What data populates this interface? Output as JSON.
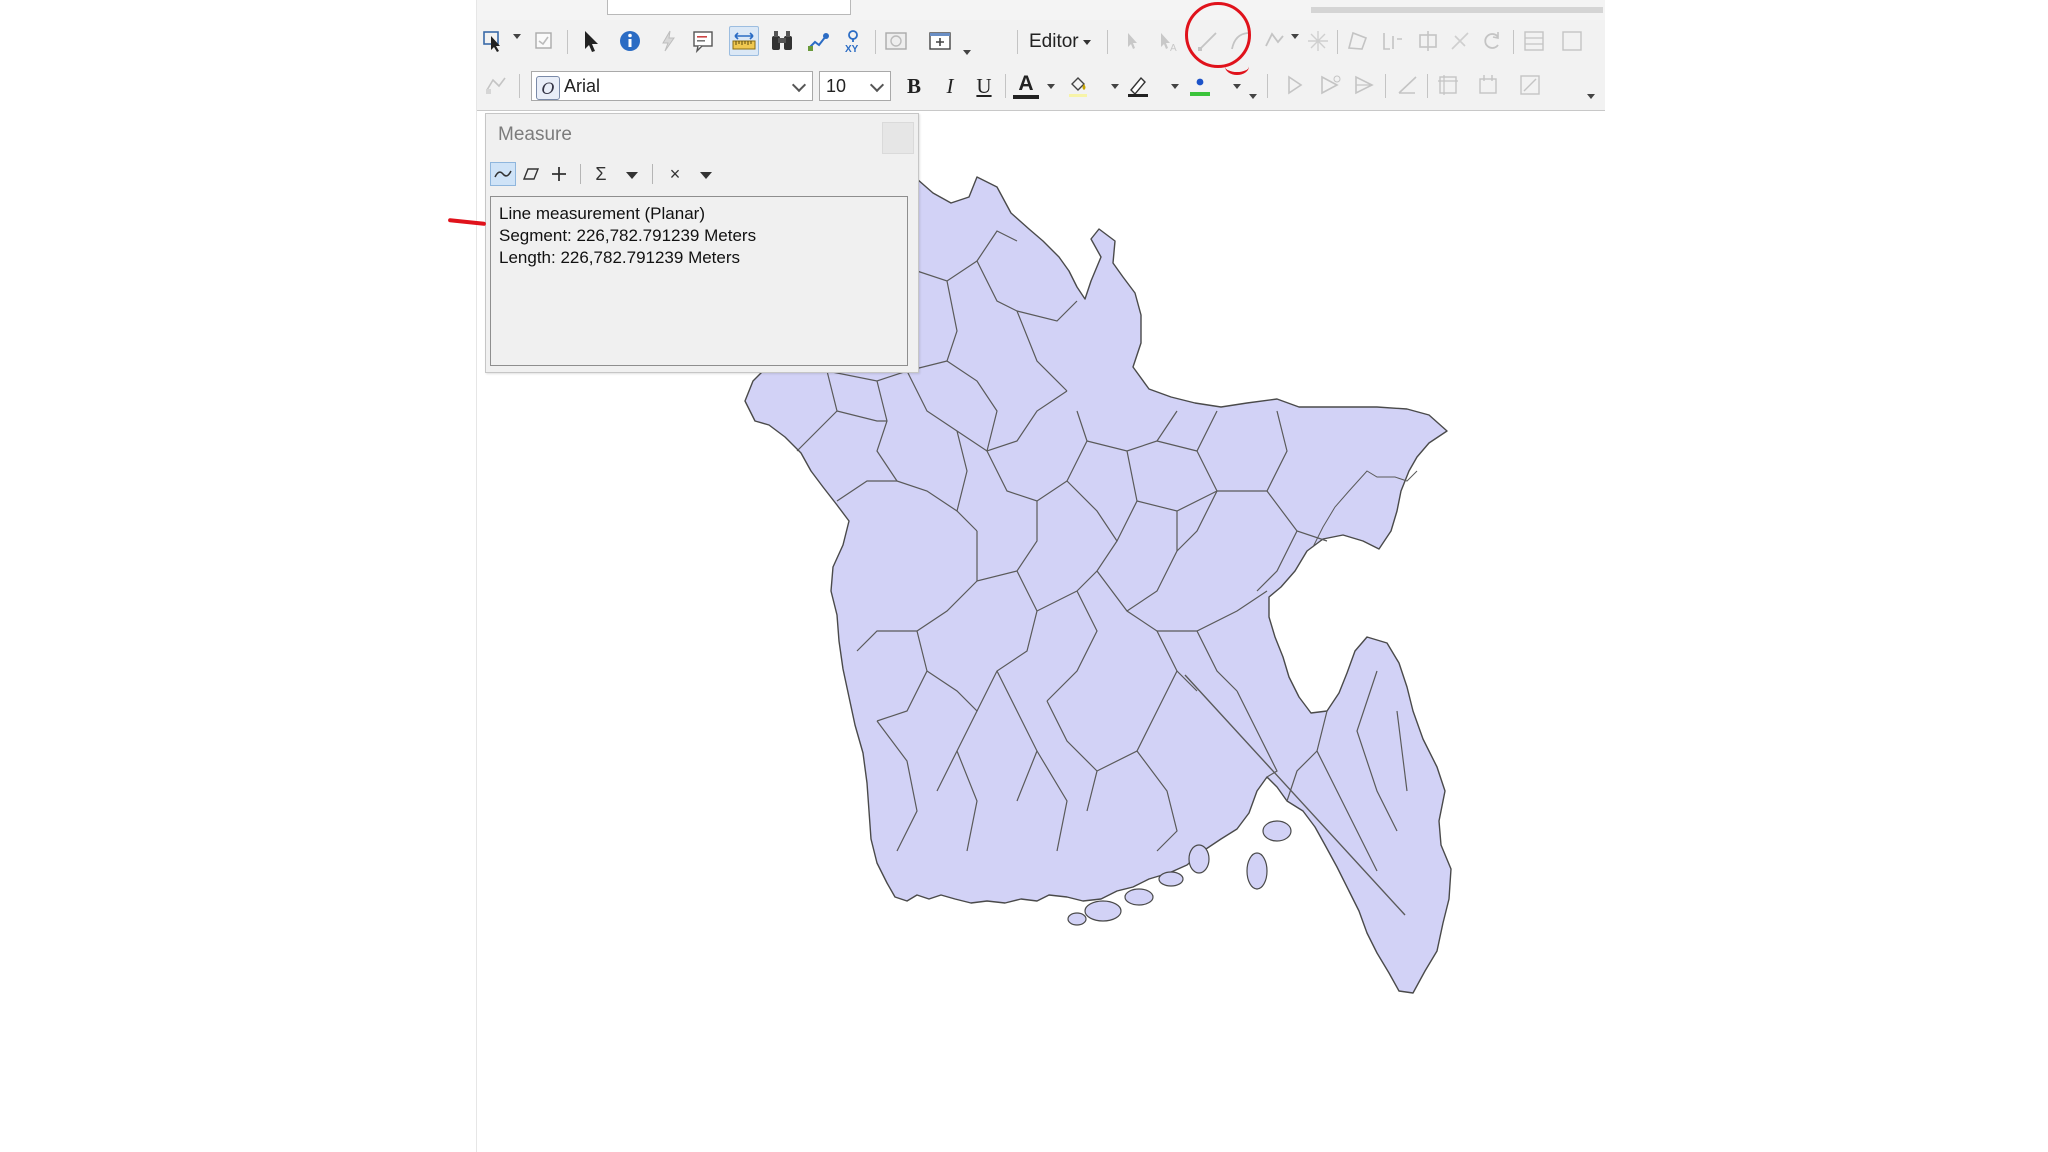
{
  "toolbar_top": {
    "editor_label": "Editor"
  },
  "toolbar_format": {
    "font_name": "Arial",
    "font_size": "10",
    "bold_label": "B",
    "italic_label": "I",
    "underline_label": "U",
    "font_color_label": "A"
  },
  "measure_window": {
    "title": "Measure",
    "tools": [
      "measure-line-icon",
      "measure-area-icon",
      "measure-feature-icon",
      "sum-icon",
      "clear-icon"
    ],
    "sum_label": "Σ",
    "clear_label": "×",
    "output": {
      "line1": "Line measurement (Planar)",
      "line2": "Segment: 226,782.791239 Meters",
      "line3": "Length: 226,782.791239 Meters"
    }
  },
  "map": {
    "fill_color": "#d2d2f6",
    "outline_color": "#4a4a4a"
  },
  "annotations": {
    "color": "#e0121b"
  }
}
